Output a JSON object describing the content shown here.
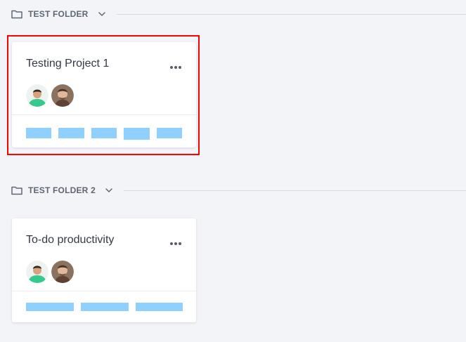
{
  "folders": [
    {
      "name": "TEST FOLDER",
      "cards": [
        {
          "title": "Testing Project 1",
          "avatars": [
            "avatar-user-1",
            "avatar-user-2"
          ],
          "progress_bar_count": 5
        }
      ]
    },
    {
      "name": "TEST FOLDER 2",
      "cards": [
        {
          "title": "To-do productivity",
          "avatars": [
            "avatar-user-1",
            "avatar-user-2"
          ],
          "progress_bar_count": 3
        }
      ]
    }
  ],
  "icons": {
    "folder": "folder-icon",
    "chevron": "chevron-down-icon",
    "more": "more-options-icon"
  },
  "colors": {
    "background": "#f3f4f8",
    "card_background": "#ffffff",
    "bar": "#8fd0ff",
    "selection_outline": "#ff0000",
    "avatar_green_shirt": "#35c98e"
  }
}
